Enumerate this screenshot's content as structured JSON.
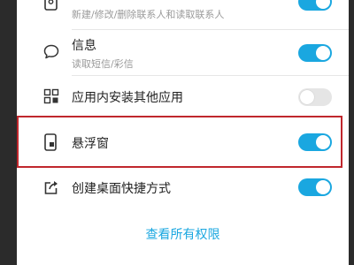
{
  "permissions": [
    {
      "title": "",
      "subtitle": "新建/修改/删除联系人和读取联系人",
      "enabled": true,
      "icon": "contacts-icon"
    },
    {
      "title": "信息",
      "subtitle": "读取短信/彩信",
      "enabled": true,
      "icon": "message-bubble-icon"
    },
    {
      "title": "应用内安装其他应用",
      "subtitle": "",
      "enabled": false,
      "icon": "app-grid-icon"
    },
    {
      "title": "悬浮窗",
      "subtitle": "",
      "enabled": true,
      "icon": "floating-window-icon"
    },
    {
      "title": "创建桌面快捷方式",
      "subtitle": "",
      "enabled": true,
      "icon": "share-shortcut-icon"
    }
  ],
  "footer": {
    "view_all_label": "查看所有权限"
  },
  "colors": {
    "accent": "#1aa7e0",
    "toggle_off": "#e5e5e5",
    "highlight": "#c0272d"
  }
}
